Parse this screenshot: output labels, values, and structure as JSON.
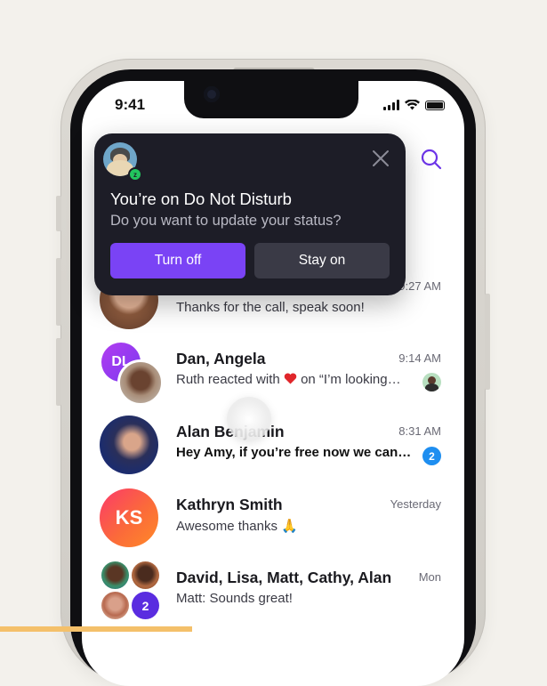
{
  "status_bar": {
    "time": "9:41"
  },
  "popup": {
    "title": "You’re on Do Not Disturb",
    "subtitle": "Do you want to update your status?",
    "primary_label": "Turn off",
    "secondary_label": "Stay on",
    "status_letter": "z"
  },
  "chats": [
    {
      "name": "",
      "message": "Thanks for the call, speak soon!",
      "time": "9:27 AM"
    },
    {
      "initials": "DL",
      "name": "Dan, Angela",
      "message_pre": "Ruth reacted with ",
      "message_post": " on “I’m looking…",
      "time": "9:14 AM"
    },
    {
      "name": "Alan Benjamin",
      "message": "Hey Amy, if you’re free now we can…",
      "time": "8:31 AM",
      "badge": "2"
    },
    {
      "initials": "KS",
      "name": "Kathryn Smith",
      "message": "Awesome thanks 🙏",
      "time": "Yesterday"
    },
    {
      "name": "David, Lisa, Matt, Cathy, Alan",
      "message": "Matt: Sounds great!",
      "time": "Mon",
      "group_count": "2"
    }
  ],
  "colors": {
    "accent": "#7a43f5",
    "badge": "#1e8ef0",
    "popup_bg": "#1d1d27"
  },
  "icons": {
    "search": "search-icon",
    "close": "close-icon",
    "heart": "heart-icon"
  }
}
